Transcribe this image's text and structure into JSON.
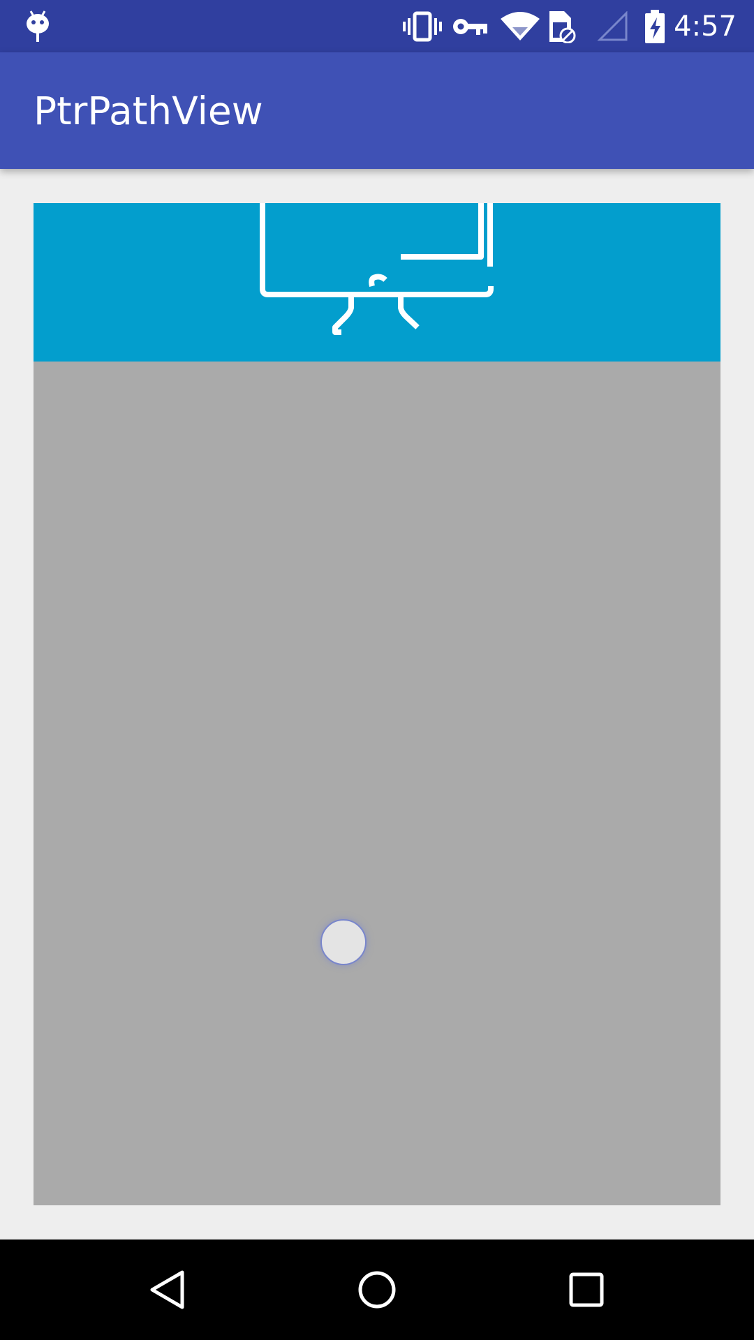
{
  "status_bar": {
    "time": "4:57",
    "icons": {
      "notification": "android-debug-icon",
      "vibrate": "vibrate-icon",
      "vpn": "vpn-key-icon",
      "wifi": "wifi-icon",
      "sim": "no-sim-icon",
      "signal": "cell-signal-empty-icon",
      "battery": "battery-charging-icon"
    },
    "color": "#303F9F"
  },
  "app_bar": {
    "title": "PtrPathView",
    "color": "#3F51B5"
  },
  "content": {
    "header_color": "#039ECD",
    "list_color": "#AAAAAA",
    "header_graphic": "ptr-path-drawing"
  },
  "nav_bar": {
    "back": "back-icon",
    "home": "home-icon",
    "recents": "recents-icon"
  }
}
